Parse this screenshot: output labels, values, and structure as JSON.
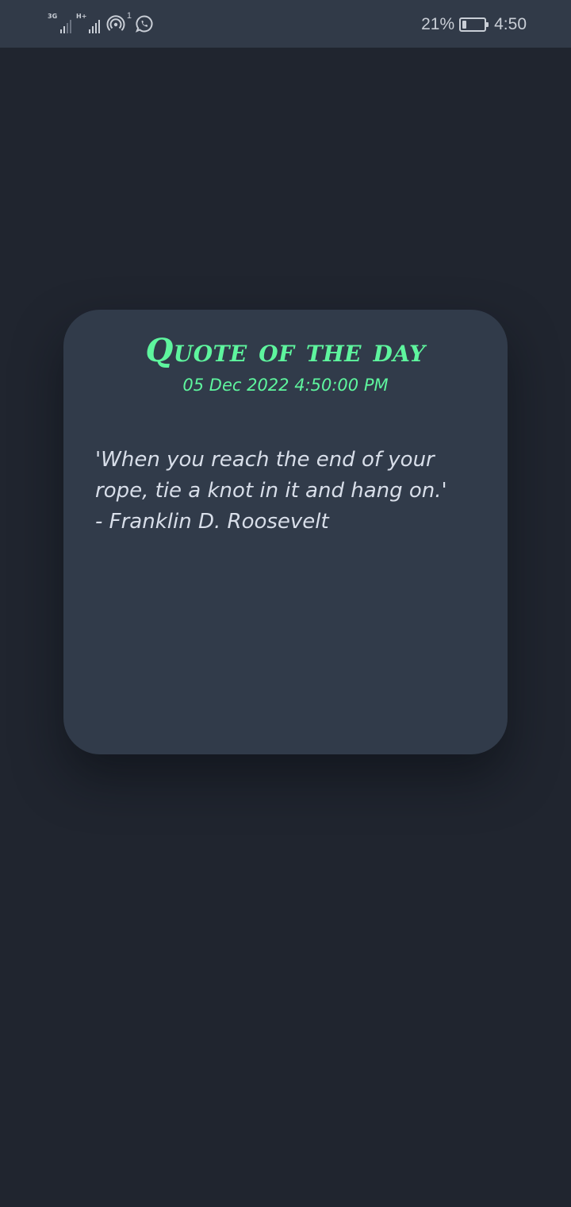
{
  "status_bar": {
    "network_1": "3G",
    "network_2": "H+",
    "hotspot_count": "1",
    "battery_percent": "21%",
    "battery_level": 0.21,
    "time": "4:50",
    "icons": [
      "signal-3g-icon",
      "signal-hplus-icon",
      "hotspot-icon",
      "whatsapp-icon",
      "battery-icon"
    ]
  },
  "card": {
    "title": "Quote of the day",
    "date": "05 Dec 2022 4:50:00 PM",
    "quote": "'When you reach the end of your rope, tie a knot in it and hang on.'",
    "author": "- Franklin D. Roosevelt"
  },
  "colors": {
    "background": "#20252f",
    "status_bar": "#313a48",
    "card": "#313b4a",
    "accent": "#5ef59e",
    "quote_text": "#d8dee9"
  }
}
